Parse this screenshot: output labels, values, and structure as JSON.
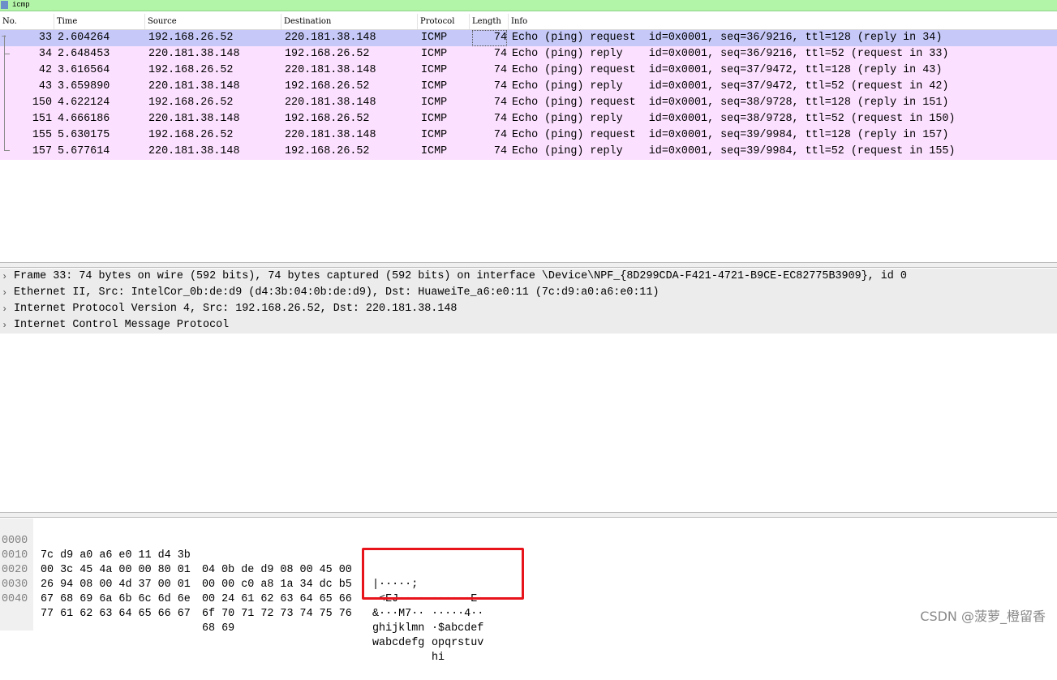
{
  "filter": {
    "value": "icmp"
  },
  "columns": [
    "No.",
    "Time",
    "Source",
    "Destination",
    "Protocol",
    "Length",
    "Info"
  ],
  "packets": [
    {
      "no": "33",
      "time": "2.604264",
      "src": "192.168.26.52",
      "dst": "220.181.38.148",
      "proto": "ICMP",
      "len": "74",
      "info": "Echo (ping) request  id=0x0001, seq=36/9216, ttl=128 (reply in 34)"
    },
    {
      "no": "34",
      "time": "2.648453",
      "src": "220.181.38.148",
      "dst": "192.168.26.52",
      "proto": "ICMP",
      "len": "74",
      "info": "Echo (ping) reply    id=0x0001, seq=36/9216, ttl=52 (request in 33)"
    },
    {
      "no": "42",
      "time": "3.616564",
      "src": "192.168.26.52",
      "dst": "220.181.38.148",
      "proto": "ICMP",
      "len": "74",
      "info": "Echo (ping) request  id=0x0001, seq=37/9472, ttl=128 (reply in 43)"
    },
    {
      "no": "43",
      "time": "3.659890",
      "src": "220.181.38.148",
      "dst": "192.168.26.52",
      "proto": "ICMP",
      "len": "74",
      "info": "Echo (ping) reply    id=0x0001, seq=37/9472, ttl=52 (request in 42)"
    },
    {
      "no": "150",
      "time": "4.622124",
      "src": "192.168.26.52",
      "dst": "220.181.38.148",
      "proto": "ICMP",
      "len": "74",
      "info": "Echo (ping) request  id=0x0001, seq=38/9728, ttl=128 (reply in 151)"
    },
    {
      "no": "151",
      "time": "4.666186",
      "src": "220.181.38.148",
      "dst": "192.168.26.52",
      "proto": "ICMP",
      "len": "74",
      "info": "Echo (ping) reply    id=0x0001, seq=38/9728, ttl=52 (request in 150)"
    },
    {
      "no": "155",
      "time": "5.630175",
      "src": "192.168.26.52",
      "dst": "220.181.38.148",
      "proto": "ICMP",
      "len": "74",
      "info": "Echo (ping) request  id=0x0001, seq=39/9984, ttl=128 (reply in 157)"
    },
    {
      "no": "157",
      "time": "5.677614",
      "src": "220.181.38.148",
      "dst": "192.168.26.52",
      "proto": "ICMP",
      "len": "74",
      "info": "Echo (ping) reply    id=0x0001, seq=39/9984, ttl=52 (request in 155)"
    }
  ],
  "details": [
    "Frame 33: 74 bytes on wire (592 bits), 74 bytes captured (592 bits) on interface \\Device\\NPF_{8D299CDA-F421-4721-B9CE-EC82775B3909}, id 0",
    "Ethernet II, Src: IntelCor_0b:de:d9 (d4:3b:04:0b:de:d9), Dst: HuaweiTe_a6:e0:11 (7c:d9:a0:a6:e0:11)",
    "Internet Protocol Version 4, Src: 192.168.26.52, Dst: 220.181.38.148",
    "Internet Control Message Protocol"
  ],
  "bytes": [
    {
      "offset": "0000",
      "hex1": "7c d9 a0 a6 e0 11 d4 3b",
      "hex2": "04 0b de d9 08 00 45 00",
      "asc1": "|·····;",
      "asc2": "······E·"
    },
    {
      "offset": "0010",
      "hex1": "00 3c 45 4a 00 00 80 01",
      "hex2": "00 00 c0 a8 1a 34 dc b5",
      "asc1": "·<EJ····",
      "asc2": "·····4··"
    },
    {
      "offset": "0020",
      "hex1": "26 94 08 00 4d 37 00 01",
      "hex2": "00 24 61 62 63 64 65 66",
      "asc1": "&···M7··",
      "asc2": "·$abcdef"
    },
    {
      "offset": "0030",
      "hex1": "67 68 69 6a 6b 6c 6d 6e",
      "hex2": "6f 70 71 72 73 74 75 76",
      "asc1": "ghijklmn",
      "asc2": "opqrstuv"
    },
    {
      "offset": "0040",
      "hex1": "77 61 62 63 64 65 66 67",
      "hex2": "68 69",
      "asc1": "wabcdefg",
      "asc2": "hi"
    }
  ],
  "watermark": "CSDN @菠萝_橙留香",
  "colors": {
    "filter_bg": "#b3f5a8",
    "row_icmp_bg": "#fce0ff",
    "row_selected_bg": "#c6c9f8",
    "highlight_border": "#e8141c"
  }
}
